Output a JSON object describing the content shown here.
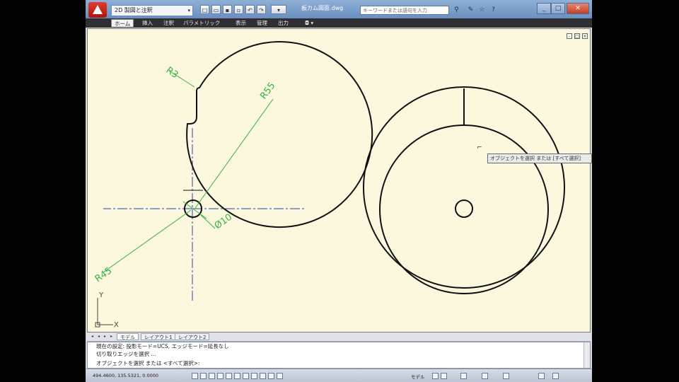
{
  "titlebar": {
    "workspace": "2D 製図と注釈",
    "document_title": "板カム図面.dwg",
    "search_placeholder": "キーワードまたは語句を入力",
    "quick_access": [
      "new",
      "open",
      "save",
      "save-as",
      "undo",
      "redo"
    ]
  },
  "ribbon": {
    "tabs": [
      "ホーム",
      "挿入",
      "注釈",
      "パラメトリック",
      "表示",
      "管理",
      "出力"
    ],
    "active_tab": "ホーム"
  },
  "drawing": {
    "dimensions": [
      "R3",
      "R55",
      "Ø10",
      "R45"
    ],
    "ucs_y": "Y",
    "ucs_x": "X",
    "tooltip": "オブジェクトを選択 または [すべて選択]"
  },
  "layout_tabs": [
    "モデル",
    "レイアウト1",
    "レイアウト2"
  ],
  "layout_active": "モデル",
  "command_line": {
    "history": [
      "現在の設定: 投影モード=UCS, エッジモード=延長なし",
      "切り取りエッジを選択 ..."
    ],
    "prompt": "オブジェクトを選択 または <すべて選択>:"
  },
  "statusbar": {
    "coordinates": "494.4600, 135.5321, 0.0000",
    "model": "モデル"
  },
  "colors": {
    "canvas": "#fbf8dd",
    "geometry": "#111111",
    "dimension": "#36b34a",
    "centerline": "#2a3fb0"
  }
}
